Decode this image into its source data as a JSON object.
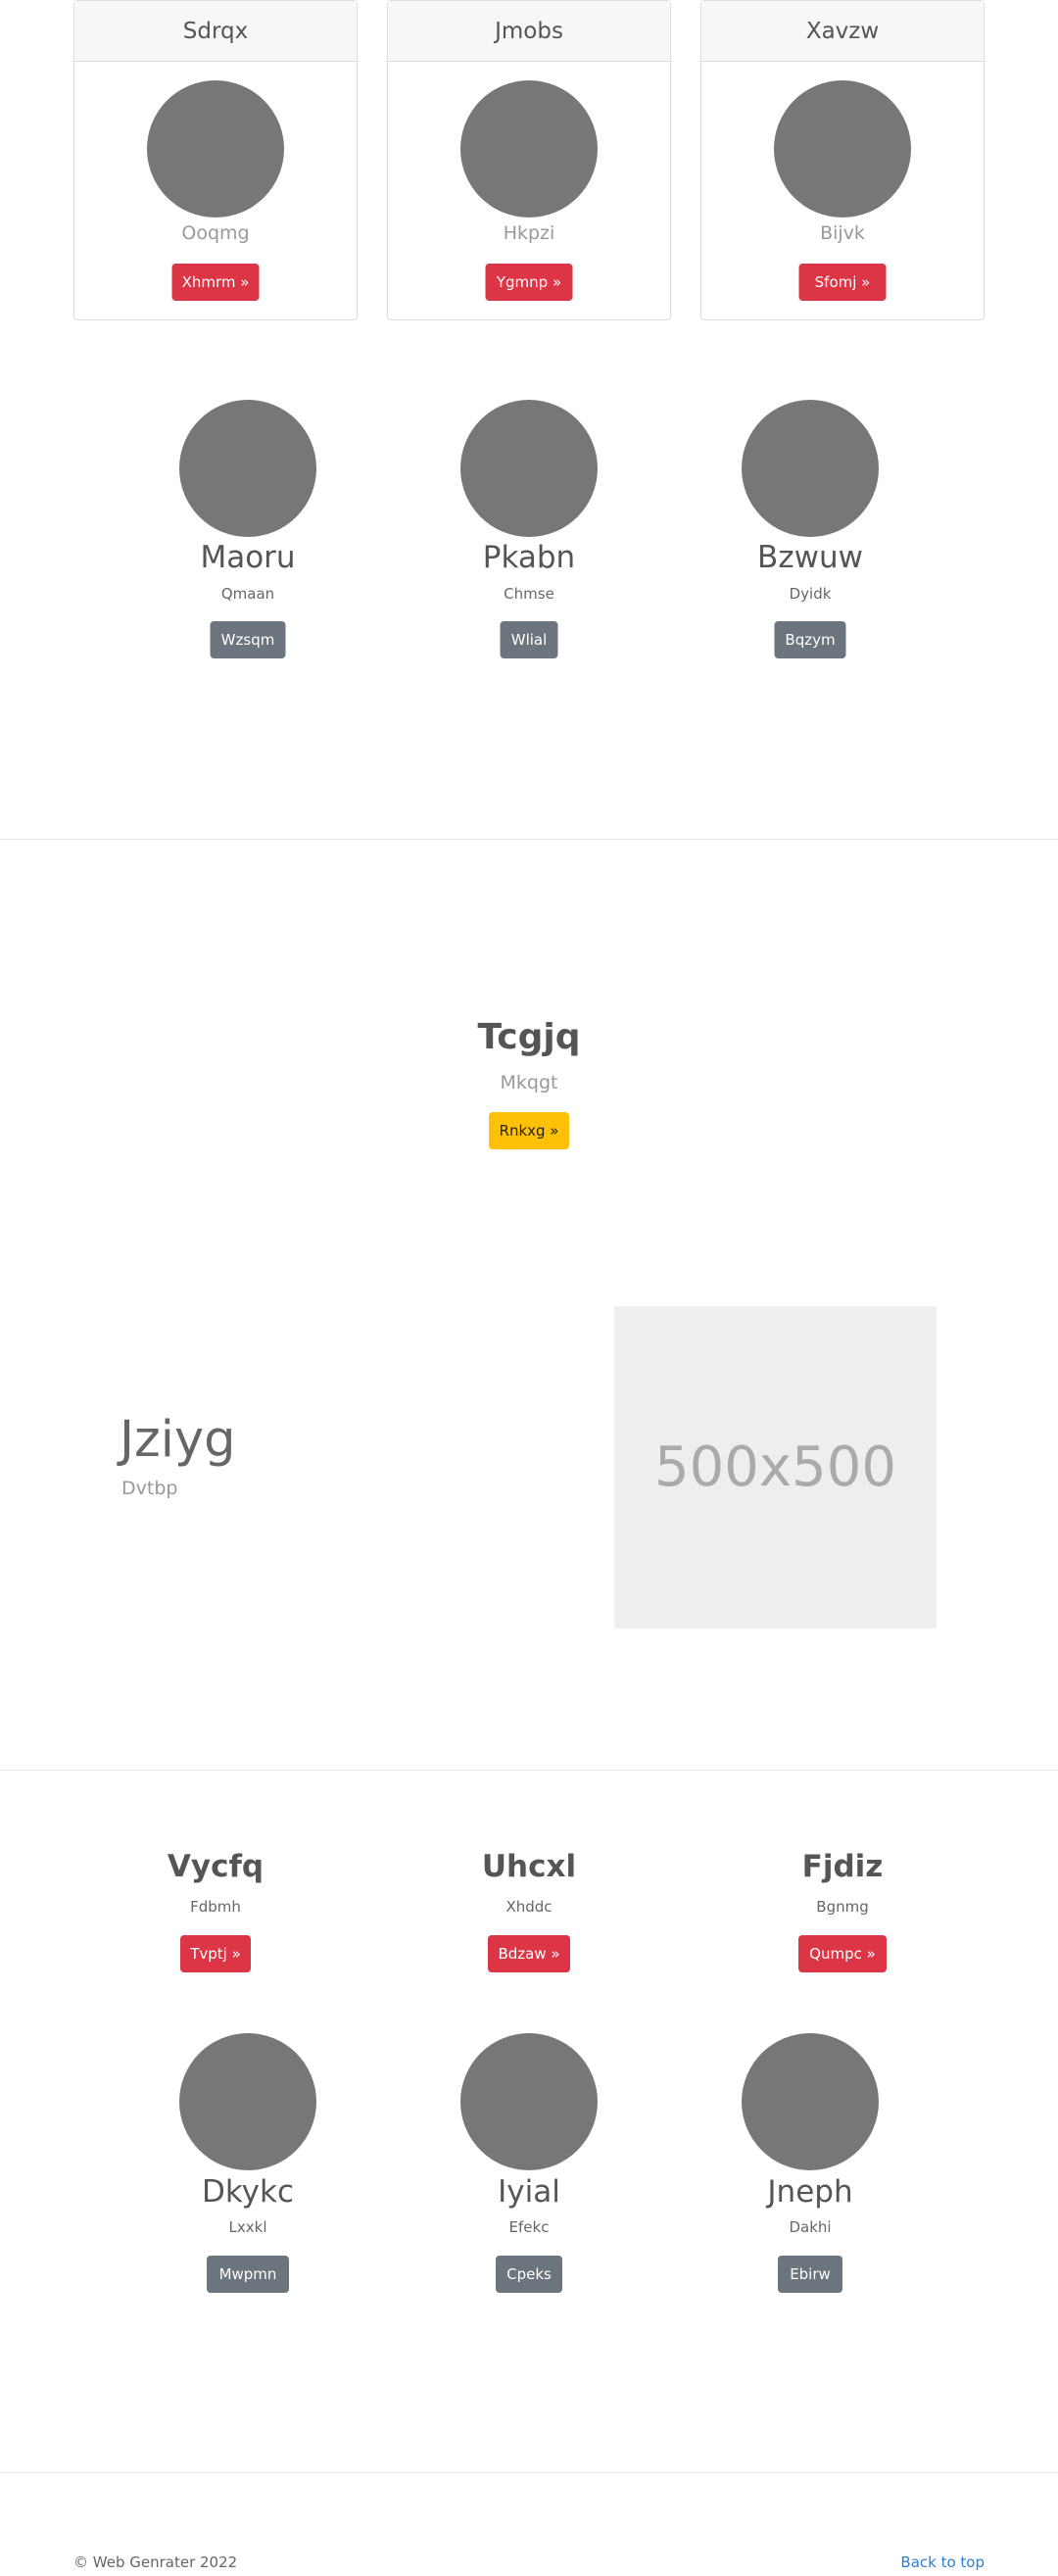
{
  "cards": [
    {
      "title": "Sdrqx",
      "subtitle": "Ooqmg",
      "button": "Xhmrm »"
    },
    {
      "title": "Jmobs",
      "subtitle": "Hkpzi",
      "button": "Ygmnp »"
    },
    {
      "title": "Xavzw",
      "subtitle": "Bijvk",
      "button": "Sfomj »"
    }
  ],
  "team1": [
    {
      "name": "Maoru",
      "role": "Qmaan",
      "button": "Wzsqm"
    },
    {
      "name": "Pkabn",
      "role": "Chmse",
      "button": "Wlial"
    },
    {
      "name": "Bzwuw",
      "role": "Dyidk",
      "button": "Bqzym"
    }
  ],
  "hero": {
    "title": "Tcgjq",
    "subtitle": "Mkqgt",
    "button": "Rnkxg »"
  },
  "feature": {
    "title": "Jziyg",
    "subtitle": "Dvtbp",
    "placeholder": "500x500"
  },
  "columns": [
    {
      "title": "Vycfq",
      "subtitle": "Fdbmh",
      "button": "Tvptj »"
    },
    {
      "title": "Uhcxl",
      "subtitle": "Xhddc",
      "button": "Bdzaw »"
    },
    {
      "title": "Fjdiz",
      "subtitle": "Bgnmg",
      "button": "Qumpc »"
    }
  ],
  "team2": [
    {
      "name": "Dkykc",
      "role": "Lxxkl",
      "button": "Mwpmn"
    },
    {
      "name": "Iyial",
      "role": "Efekc",
      "button": "Cpeks"
    },
    {
      "name": "Jneph",
      "role": "Dakhi",
      "button": "Ebirw"
    }
  ],
  "footer": {
    "copyright": "© Web Genrater 2022",
    "back_to_top": "Back to top"
  }
}
